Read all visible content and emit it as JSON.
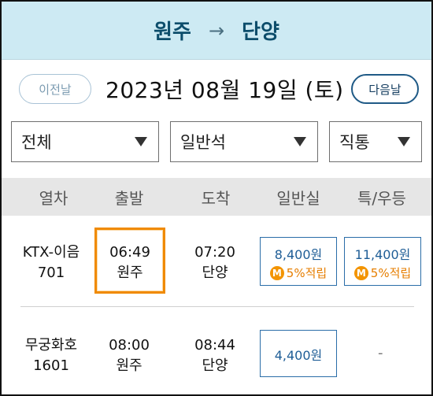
{
  "route": {
    "from": "원주",
    "arrow": "→",
    "to": "단양"
  },
  "date_nav": {
    "prev_label": "이전날",
    "date": "2023년 08월 19일 (토)",
    "next_label": "다음날"
  },
  "filters": [
    {
      "value": "전체"
    },
    {
      "value": "일반석"
    },
    {
      "value": "직통"
    }
  ],
  "columns": [
    "열차",
    "출발",
    "도착",
    "일반실",
    "특/우등"
  ],
  "trains": [
    {
      "name": "KTX-이음",
      "number": "701",
      "dep_time": "06:49",
      "dep_station": "원주",
      "arr_time": "07:20",
      "arr_station": "단양",
      "general_fare": "8,400원",
      "general_mileage": "5%적립",
      "special_fare": "11,400원",
      "special_mileage": "5%적립",
      "selected": true
    },
    {
      "name": "무궁화호",
      "number": "1601",
      "dep_time": "08:00",
      "dep_station": "원주",
      "arr_time": "08:44",
      "arr_station": "단양",
      "general_fare": "4,400원",
      "special_fare": "-"
    }
  ],
  "mileage_icon": "M",
  "colors": {
    "header_bg": "#cdeaf3",
    "header_text": "#0c4d6b",
    "selected_border": "#f08a00",
    "fare_blue": "#1e5d96",
    "mileage_orange": "#e67e00"
  }
}
